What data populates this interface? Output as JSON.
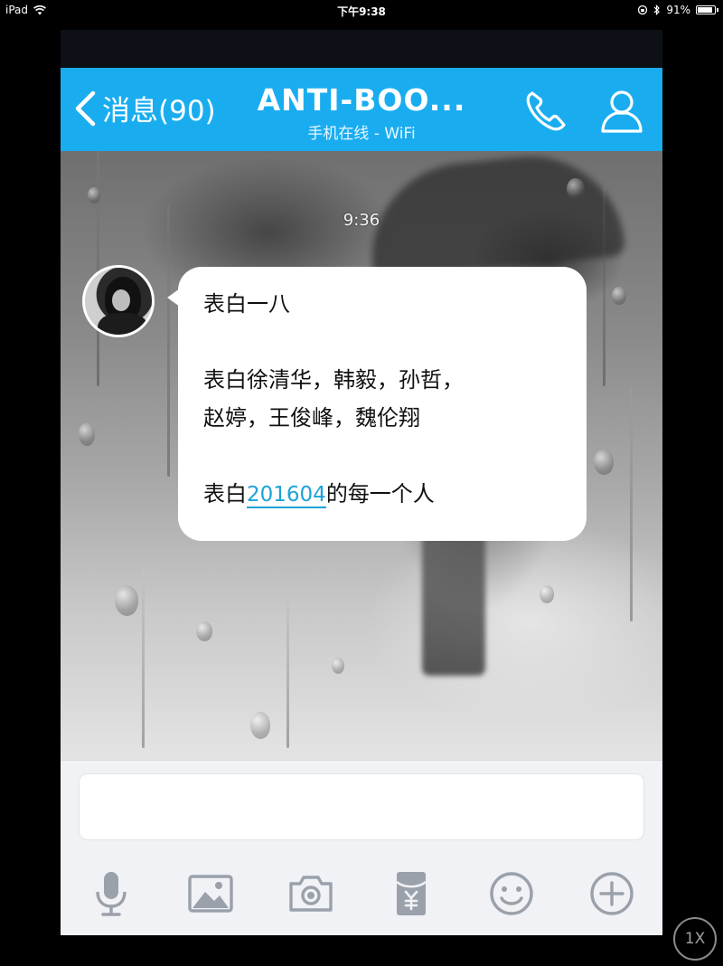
{
  "status_bar": {
    "device": "iPad",
    "time": "下午9:38",
    "battery": "91%",
    "battery_level": 0.91
  },
  "nav": {
    "back_label": "消息(90)",
    "title": "ANTI-BOO...",
    "subtitle": "手机在线 - WiFi",
    "bar_color": "#19adf0",
    "icons": [
      "chevron-left-icon",
      "phone-icon",
      "person-icon"
    ]
  },
  "chat": {
    "timestamp": "9:36",
    "message": {
      "line1": "表白一八",
      "line2": "表白徐清华，韩毅，孙哲，",
      "line3": "赵婷，王俊峰，魏伦翔",
      "line4_prefix": "表白",
      "line4_link": "201604",
      "line4_suffix": "的每一个人",
      "link_color": "#1da3d8"
    }
  },
  "input": {
    "placeholder": ""
  },
  "toolbar": {
    "icons": [
      "microphone-icon",
      "image-icon",
      "camera-icon",
      "red-packet-icon",
      "emoji-icon",
      "plus-circle-icon"
    ]
  },
  "zoom_badge": "1X"
}
